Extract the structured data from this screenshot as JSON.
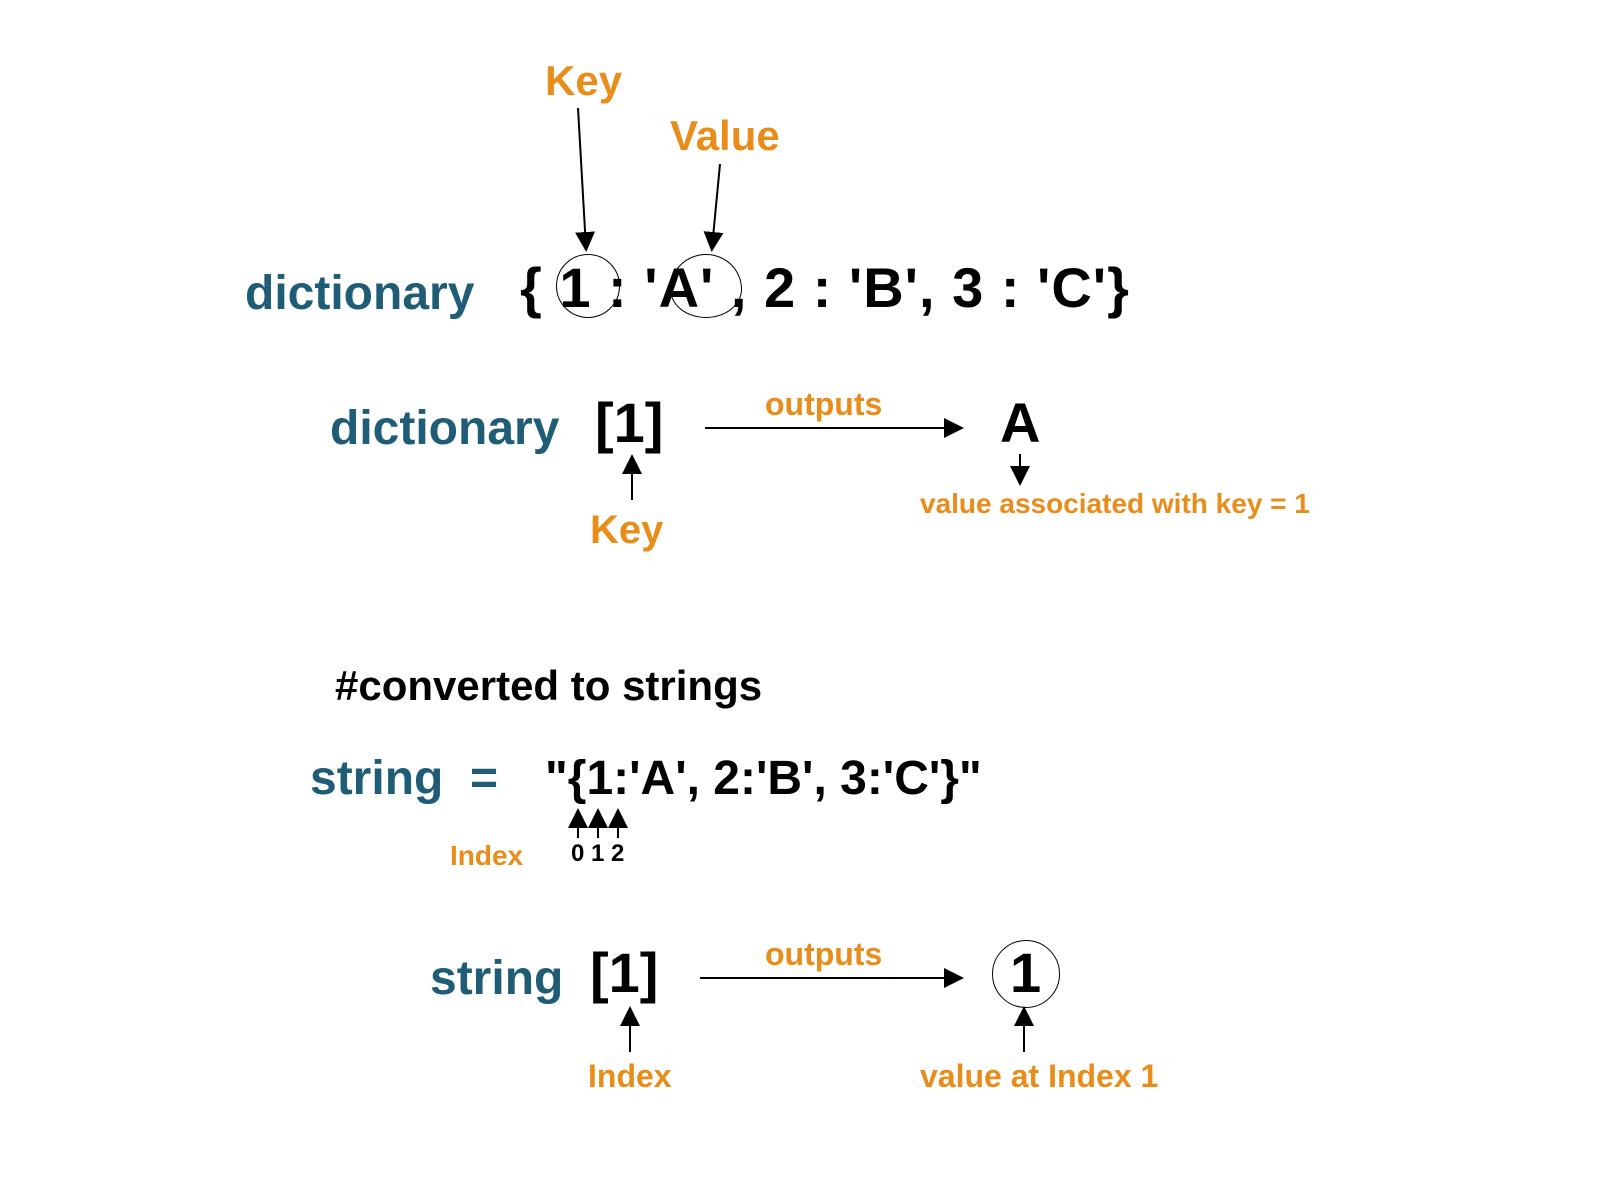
{
  "labels": {
    "key": "Key",
    "value": "Value",
    "dictionary": "dictionary",
    "dictionary_literal": "{  1  : 'A' , 2 : 'B', 3 : 'C'}",
    "bracket_one": "[1]",
    "outputs": "outputs",
    "result_A": "A",
    "value_assoc": "value associated with key = 1",
    "comment": "#converted to strings",
    "string": "string",
    "equals": "=",
    "string_literal": "\"{1:'A', 2:'B', 3:'C'}\"",
    "index": "Index",
    "idx0": "0",
    "idx1": "1",
    "idx2": "2",
    "string_out": "1",
    "value_at_index": "value at Index  1"
  }
}
